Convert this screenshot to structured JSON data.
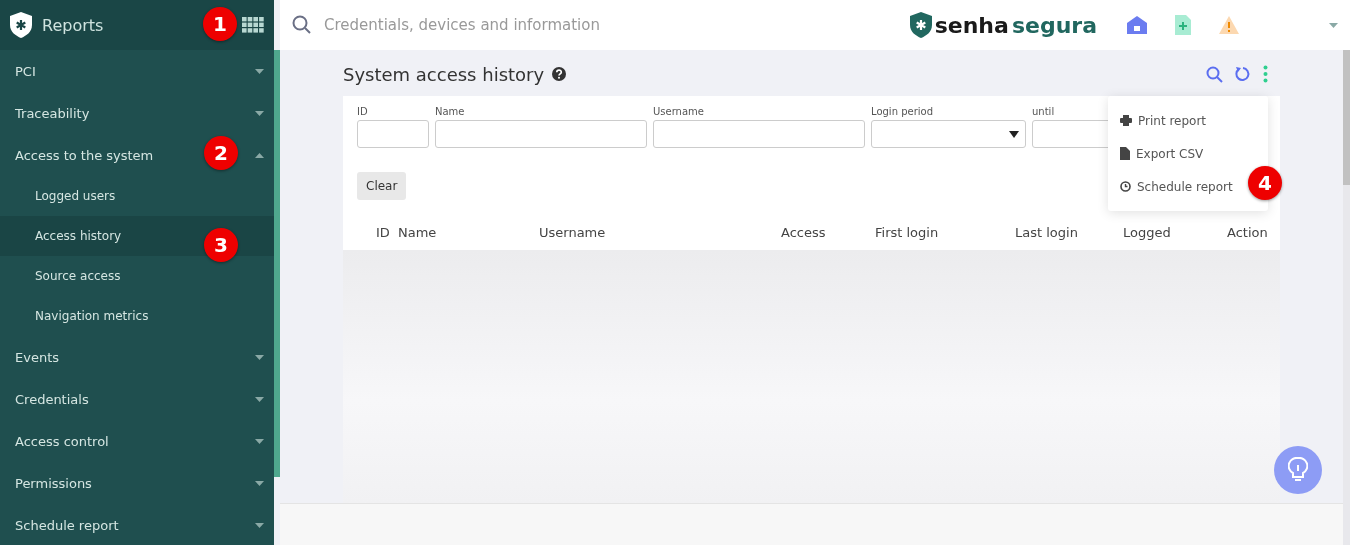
{
  "sidebar": {
    "title": "Reports",
    "items": [
      {
        "label": "PCI",
        "expanded": false
      },
      {
        "label": "Traceability",
        "expanded": false
      },
      {
        "label": "Access to the system",
        "expanded": true,
        "children": [
          {
            "label": "Logged users",
            "selected": false
          },
          {
            "label": "Access history",
            "selected": true
          },
          {
            "label": "Source access",
            "selected": false
          },
          {
            "label": "Navigation metrics",
            "selected": false
          }
        ]
      },
      {
        "label": "Events",
        "expanded": false
      },
      {
        "label": "Credentials",
        "expanded": false
      },
      {
        "label": "Access control",
        "expanded": false
      },
      {
        "label": "Permissions",
        "expanded": false
      },
      {
        "label": "Schedule report",
        "expanded": false
      }
    ]
  },
  "topbar": {
    "search": {
      "placeholder": "Credentials, devices and information"
    },
    "logo": [
      "senha",
      "segura"
    ]
  },
  "page": {
    "title": "System access history",
    "filters": [
      {
        "label": "ID",
        "kind": "text"
      },
      {
        "label": "Name",
        "kind": "text"
      },
      {
        "label": "Username",
        "kind": "text"
      },
      {
        "label": "Login period",
        "kind": "select"
      },
      {
        "label": "until",
        "kind": "text"
      }
    ],
    "clear_button": "Clear",
    "table": {
      "columns": [
        "ID",
        "Name",
        "Username",
        "Access",
        "First login",
        "Last login",
        "Logged",
        "Action"
      ]
    },
    "menu": [
      "Print report",
      "Export CSV",
      "Schedule report"
    ]
  },
  "callouts": [
    "1",
    "2",
    "3",
    "4"
  ]
}
